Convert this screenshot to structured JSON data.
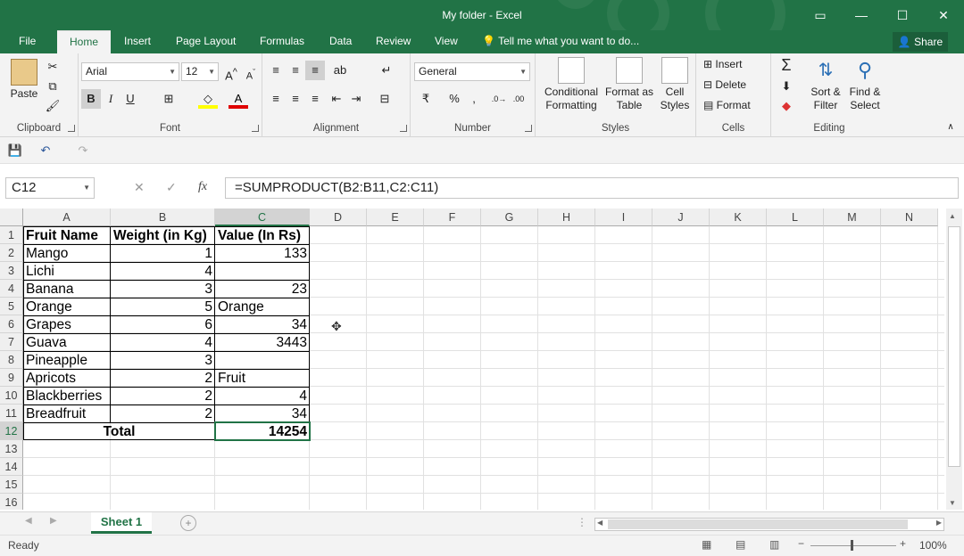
{
  "window": {
    "title": "My folder - Excel"
  },
  "tabs": {
    "file": "File",
    "home": "Home",
    "insert": "Insert",
    "page_layout": "Page Layout",
    "formulas": "Formulas",
    "data": "Data",
    "review": "Review",
    "view": "View",
    "tell_me": "Tell me what you want to do...",
    "share": "Share"
  },
  "ribbon": {
    "clipboard": {
      "paste": "Paste",
      "label": "Clipboard"
    },
    "font": {
      "name": "Arial",
      "size": "12",
      "bold": "B",
      "italic": "I",
      "underline": "U",
      "label": "Font"
    },
    "alignment": {
      "label": "Alignment"
    },
    "number": {
      "format": "General",
      "percent": "%",
      "comma": ",",
      "label": "Number"
    },
    "styles": {
      "conditional1": "Conditional",
      "conditional2": "Formatting",
      "format_table1": "Format as",
      "format_table2": "Table",
      "cell_styles1": "Cell",
      "cell_styles2": "Styles",
      "label": "Styles"
    },
    "cells": {
      "insert": "Insert",
      "delete": "Delete",
      "format": "Format",
      "label": "Cells"
    },
    "editing": {
      "sort1": "Sort &",
      "sort2": "Filter",
      "find1": "Find &",
      "find2": "Select",
      "label": "Editing"
    }
  },
  "formula_bar": {
    "name_box": "C12",
    "formula": "=SUMPRODUCT(B2:B11,C2:C11)",
    "fx": "fx"
  },
  "grid": {
    "columns": [
      "A",
      "B",
      "C",
      "D",
      "E",
      "F",
      "G",
      "H",
      "I",
      "J",
      "K",
      "L",
      "M",
      "N"
    ],
    "rows": [
      "1",
      "2",
      "3",
      "4",
      "5",
      "6",
      "7",
      "8",
      "9",
      "10",
      "11",
      "12",
      "13",
      "14",
      "15",
      "16"
    ],
    "headers": [
      "Fruit Name",
      "Weight (in Kg)",
      "Value (In Rs)"
    ],
    "data": [
      [
        "Mango",
        "1",
        "133"
      ],
      [
        "Lichi",
        "4",
        ""
      ],
      [
        "Banana",
        "3",
        "23"
      ],
      [
        "Orange",
        "5",
        "Orange"
      ],
      [
        "Grapes",
        "6",
        "34"
      ],
      [
        "Guava",
        "4",
        "3443"
      ],
      [
        "Pineapple",
        "3",
        ""
      ],
      [
        "Apricots",
        "2",
        "Fruit"
      ],
      [
        "Blackberries",
        "2",
        "4"
      ],
      [
        "Breadfruit",
        "2",
        "34"
      ]
    ],
    "total_label": "Total",
    "total_value": "14254"
  },
  "sheet_tab": "Sheet 1",
  "status": {
    "ready": "Ready",
    "zoom": "100%"
  }
}
